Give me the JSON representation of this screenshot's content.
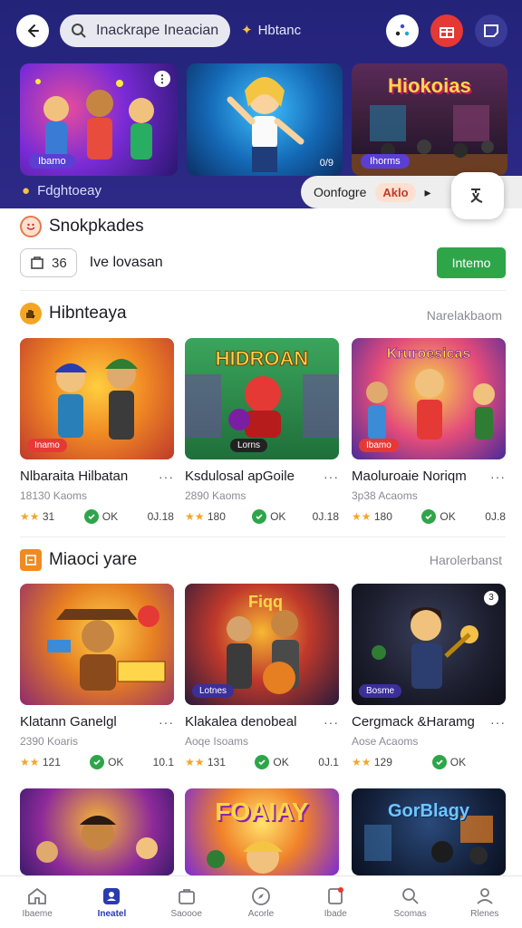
{
  "header": {
    "search_placeholder": "Inackrape Ineacian",
    "user_label": "Hbtanc",
    "banners": [
      {
        "tag": "Ibamo",
        "has_menu": true
      },
      {
        "tag": "",
        "number": "0/9"
      },
      {
        "tag": "Ihorms",
        "title": "Hiokoias"
      }
    ],
    "footer_label": "Fdghtoeay",
    "filter_label": "Oonfogre",
    "filter_badge": "Aklo",
    "filter_arrow": "▸"
  },
  "snackbar_section": {
    "title": "Snokpkades",
    "count": "36",
    "info_text": "Ive lovasan",
    "button_label": "Intemo"
  },
  "section1": {
    "title": "Hibnteaya",
    "more": "Narelakbaom",
    "cards": [
      {
        "tag": "Inamo",
        "title": "Nlbaraita Hilbatan",
        "sub": "18130 Kaoms",
        "rating": "31",
        "ok": "OK",
        "num": "0J.18"
      },
      {
        "tag": "Lorns",
        "title": "Ksdulosal apGoile",
        "sub": "2890 Kaoms",
        "rating": "180",
        "ok": "OK",
        "num": "0J.18"
      },
      {
        "tag": "Ibamo",
        "title": "Maoluroaie Noriqm",
        "sub": "3p38 Acaoms",
        "rating": "180",
        "ok": "OK",
        "num": "0J.8"
      }
    ]
  },
  "section2": {
    "title": "Miaoci yare",
    "more": "Harolerbanst",
    "cards": [
      {
        "tag": "",
        "title": "Klatann Ganelgl",
        "sub": "2390 Koaris",
        "rating": "121",
        "ok": "OK",
        "num": "10.1"
      },
      {
        "tag": "Lotnes",
        "title": "Klakalea denobeal",
        "sub": "Aoqe Isoams",
        "rating": "131",
        "ok": "OK",
        "num": "0J.1"
      },
      {
        "tag": "Bosme",
        "title": "Cergmack &Haramg",
        "sub": "Aose Acaoms",
        "rating": "129",
        "ok": "OK",
        "num": ""
      }
    ]
  },
  "section3": {
    "cards": [
      {
        "overlay": ""
      },
      {
        "overlay": "FOAIAY"
      },
      {
        "overlay": "GorBlagy"
      }
    ]
  },
  "nav": {
    "items": [
      {
        "label": "Ibaeme",
        "icon": "home-icon",
        "active": false
      },
      {
        "label": "Ineatel",
        "icon": "profile-card-icon",
        "active": true
      },
      {
        "label": "Saoooe",
        "icon": "bag-icon",
        "active": false
      },
      {
        "label": "Acorle",
        "icon": "compass-icon",
        "active": false
      },
      {
        "label": "Ibade",
        "icon": "bell-icon",
        "active": false
      },
      {
        "label": "Scomas",
        "icon": "search-icon",
        "active": false
      },
      {
        "label": "Rlenes",
        "icon": "person-icon",
        "active": false
      }
    ]
  },
  "colors": {
    "accent": "#2b3bb0",
    "header": "#24237a",
    "green": "#2fa54a",
    "star": "#f2a72a"
  }
}
